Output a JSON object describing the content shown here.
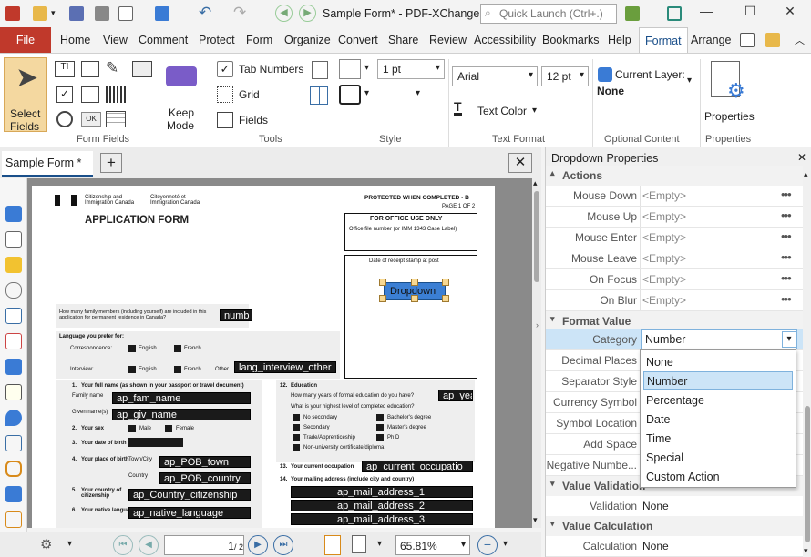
{
  "window": {
    "title": "Sample Form* - PDF-XChange ...",
    "quick_launch_placeholder": "Quick Launch (Ctrl+.)"
  },
  "menu": {
    "tabs": [
      "File",
      "Home",
      "View",
      "Comment",
      "Protect",
      "Form",
      "Organize",
      "Convert",
      "Share",
      "Review",
      "Accessibility",
      "Bookmarks",
      "Help",
      "Format",
      "Arrange"
    ],
    "active": "Format"
  },
  "ribbon": {
    "form_fields": {
      "select_label_1": "Select",
      "select_label_2": "Fields",
      "keep_label_1": "Keep",
      "keep_label_2": "Mode",
      "group": "Form Fields"
    },
    "tools": {
      "tab_numbers": "Tab Numbers",
      "grid": "Grid",
      "fields": "Fields",
      "group": "Tools"
    },
    "style": {
      "line_width": "1 pt",
      "group": "Style"
    },
    "text_format": {
      "font": "Arial",
      "size": "12 pt",
      "text_color": "Text Color",
      "group": "Text Format"
    },
    "optional_content": {
      "current_layer": "Current Layer:",
      "layer_value": "None",
      "group": "Optional Content"
    },
    "properties": {
      "label": "Properties",
      "group": "Properties"
    }
  },
  "document": {
    "tab_title": "Sample Form *",
    "form": {
      "agency_en": "Citizenship and Immigration Canada",
      "agency_fr": "Citoyenneté et Immigration Canada",
      "protected": "PROTECTED WHEN COMPLETED - B",
      "page_of": "PAGE 1 OF 2",
      "title": "APPLICATION FORM",
      "office_use": "FOR OFFICE USE ONLY",
      "office_file": "Office file number (or IMM 1343 Case Label)",
      "receipt_stamp": "Date of receipt stamp at post",
      "dropdown_field": "Dropdown",
      "family_q": "How many family members (including yourself) are included in this application for permanent residence in Canada?",
      "family_field": "numb",
      "language_pref": "Language you prefer for:",
      "correspondence": "Correspondence:",
      "interview": "Interview:",
      "english": "English",
      "french": "French",
      "other": "Other",
      "lang_interview_field": "lang_interview_other",
      "q1": "1.",
      "full_name": "Your full name (as shown in your passport or travel document)",
      "family_name": "Family name",
      "family_name_field": "ap_fam_name",
      "given_names": "Given name(s)",
      "given_names_field": "ap_giv_name",
      "q2": "2.",
      "sex": "Your sex",
      "male": "Male",
      "female": "Female",
      "q3": "3.",
      "dob": "Your date of birth",
      "q4": "4.",
      "pob": "Your place of birth",
      "town": "Town/City",
      "pob_town_field": "ap_POB_town",
      "country": "Country",
      "pob_country_field": "ap_POB_country",
      "q5": "5.",
      "citizenship": "Your country of citizenship",
      "citizenship_field": "ap_Country_citizenship",
      "q6": "6.",
      "native_lang": "Your native language",
      "native_lang_field": "ap_native_language",
      "q12": "12.",
      "education": "Education",
      "edu_years": "How many years of formal education do you have?",
      "edu_years_field": "ap_yea",
      "edu_level": "What is your highest level of completed education?",
      "edu_options": [
        "No secondary",
        "Secondary",
        "Trade/Apprenticeship",
        "Non-university certificate/diploma"
      ],
      "edu_options_right": [
        "Bachelor's degree",
        "Master's degree",
        "Ph D"
      ],
      "q13": "13.",
      "occupation": "Your current occupation",
      "occupation_field": "ap_current_occupatio",
      "q14": "14.",
      "mail_address": "Your mailing address (include city and country)",
      "mail_fields": [
        "ap_mail_address_1",
        "ap_mail_address_2",
        "ap_mail_address_3"
      ]
    }
  },
  "statusbar": {
    "page": "1",
    "page_total": "/ 2",
    "zoom": "65.81%"
  },
  "properties": {
    "title": "Dropdown Properties",
    "actions_section": "Actions",
    "actions": [
      {
        "label": "Mouse Down",
        "value": "<Empty>"
      },
      {
        "label": "Mouse Up",
        "value": "<Empty>"
      },
      {
        "label": "Mouse Enter",
        "value": "<Empty>"
      },
      {
        "label": "Mouse Leave",
        "value": "<Empty>"
      },
      {
        "label": "On Focus",
        "value": "<Empty>"
      },
      {
        "label": "On Blur",
        "value": "<Empty>"
      }
    ],
    "format_section": "Format Value",
    "format_rows": [
      {
        "label": "Category",
        "value": "Number"
      },
      {
        "label": "Decimal Places",
        "value": ""
      },
      {
        "label": "Separator Style",
        "value": ""
      },
      {
        "label": "Currency Symbol",
        "value": ""
      },
      {
        "label": "Symbol Location",
        "value": ""
      },
      {
        "label": "Add Space",
        "value": ""
      },
      {
        "label": "Negative Numbe...",
        "value": ""
      }
    ],
    "validation_section": "Value Validation",
    "validation": {
      "label": "Validation",
      "value": "None"
    },
    "calculation_section": "Value Calculation",
    "calculation": {
      "label": "Calculation",
      "value": "None"
    },
    "dropdown_options": [
      "None",
      "Number",
      "Percentage",
      "Date",
      "Time",
      "Special",
      "Custom Action"
    ],
    "dropdown_selected": "Number"
  },
  "colors": {
    "file_tab": "#c0392b",
    "accent": "#1a4f8a",
    "selection": "#cce4f7"
  }
}
